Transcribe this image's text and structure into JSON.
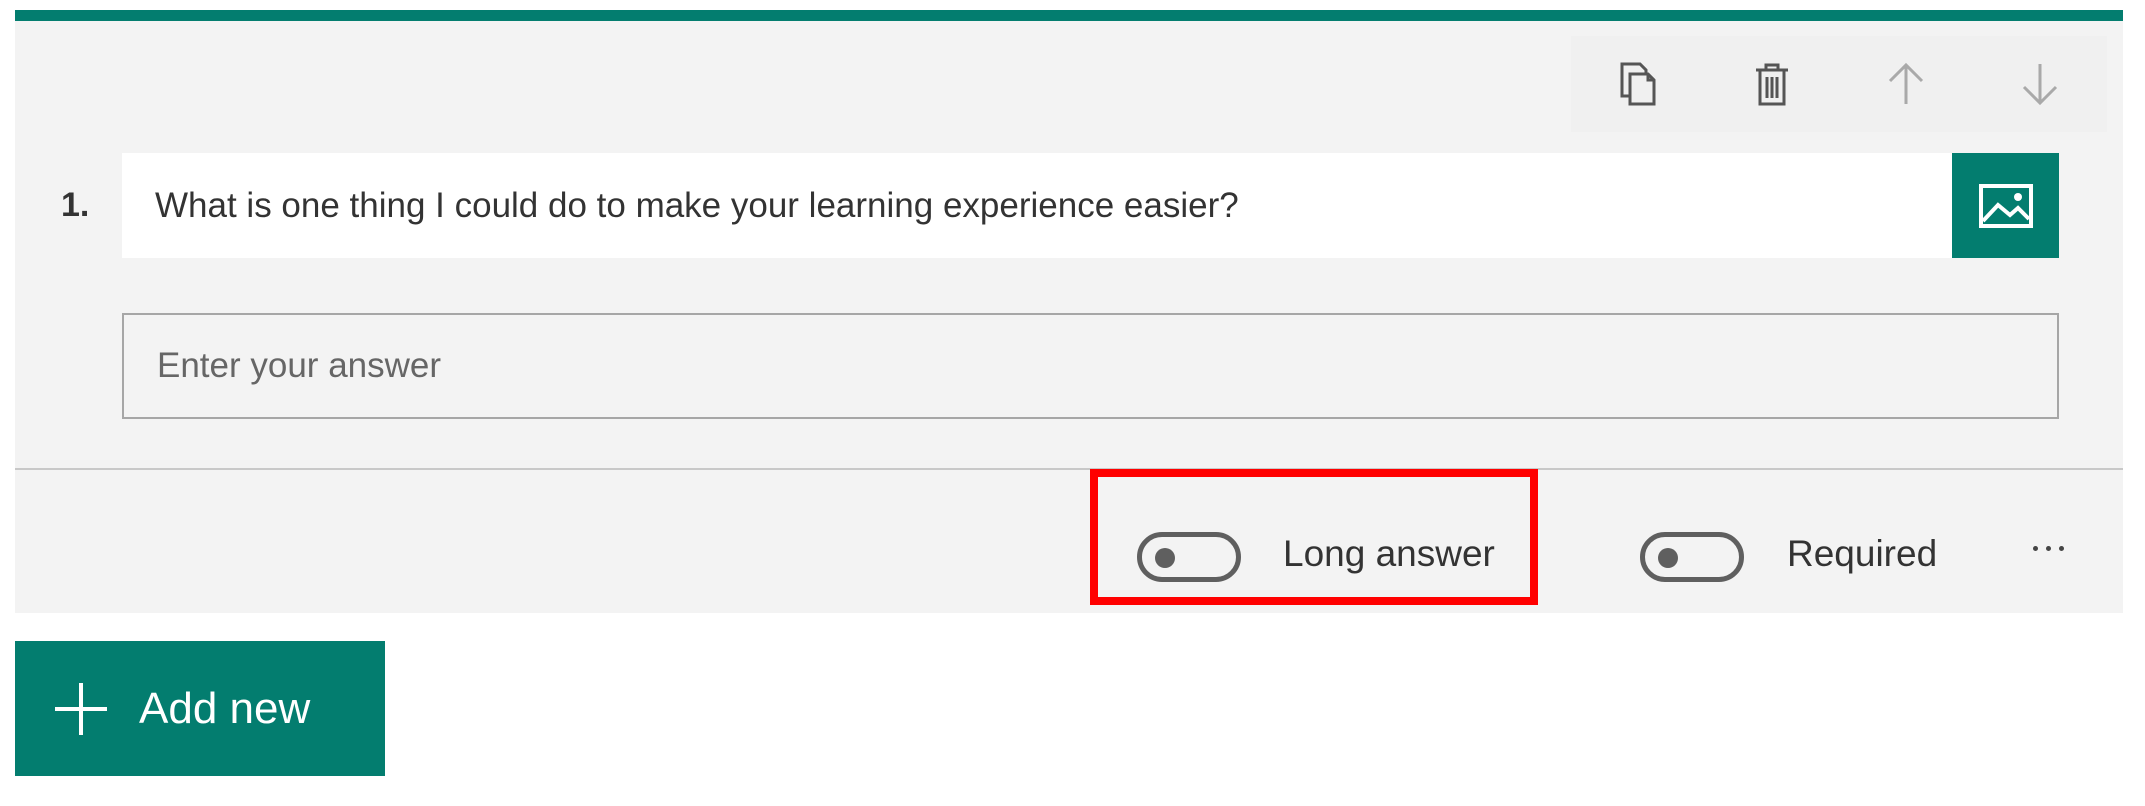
{
  "colors": {
    "accent": "#037d6f",
    "highlight": "#ff0000",
    "card_bg": "#f3f3f3"
  },
  "toolbar": {
    "icons": [
      "copy-icon",
      "trash-icon",
      "arrow-up-icon",
      "arrow-down-icon"
    ]
  },
  "question": {
    "number": "1.",
    "title": "What is one thing I could do to make your learning experience easier?",
    "image_icon": "image-icon",
    "answer_placeholder": "Enter your answer"
  },
  "options": {
    "long_answer": {
      "label": "Long answer",
      "on": false
    },
    "required": {
      "label": "Required",
      "on": false
    },
    "more_icon": "more-options-icon"
  },
  "add_new": {
    "label": "Add new",
    "icon": "plus-icon"
  }
}
